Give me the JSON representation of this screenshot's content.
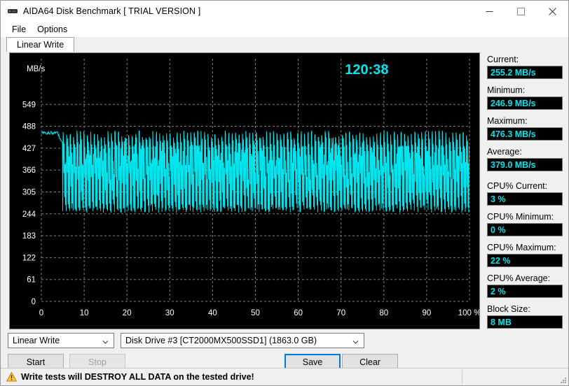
{
  "window": {
    "title": "AIDA64 Disk Benchmark  [ TRIAL VERSION ]",
    "icon": "disk-drive-icon",
    "minimize": "—",
    "maximize": "□",
    "close": "✕"
  },
  "menu": {
    "items": [
      {
        "label": "File"
      },
      {
        "label": "Options"
      }
    ]
  },
  "tabs": [
    {
      "label": "Linear Write",
      "active": true
    }
  ],
  "chart_data": {
    "type": "line",
    "title": "",
    "timer": "120:38",
    "xlabel": "",
    "ylabel": "MB/s",
    "x_unit": "%",
    "xticks": [
      "0",
      "10",
      "20",
      "30",
      "40",
      "50",
      "60",
      "70",
      "80",
      "90",
      "100 %"
    ],
    "xvalues": [
      0,
      10,
      20,
      30,
      40,
      50,
      60,
      70,
      80,
      90,
      100
    ],
    "yticks": [
      "549",
      "488",
      "427",
      "366",
      "305",
      "244",
      "183",
      "122",
      "61",
      "0"
    ],
    "yvalues": [
      549,
      488,
      427,
      366,
      305,
      244,
      183,
      122,
      61,
      0
    ],
    "ylim": [
      0,
      610
    ],
    "xlim": [
      0,
      100
    ],
    "grid": true,
    "grid_color": "#808080",
    "series_color": "#00e5ee",
    "background": "#000000",
    "axis_text_color": "#ffffff",
    "series": [
      {
        "name": "Linear Write",
        "description": "Sustained write speed oscillating between SLC-cache bursts (~476 MB/s) and direct-to-TLC writes (~247 MB/s) after the first ~5% of the drive.",
        "plateau_start_pct": 0,
        "plateau_end_pct": 5,
        "plateau_value": 474,
        "oscillation_start_pct": 5,
        "oscillation_high": 476.3,
        "oscillation_low": 247,
        "points_hint": "sawtooth, ~120 cycles across remaining 95%"
      }
    ]
  },
  "stats": [
    {
      "name": "current",
      "label": "Current:",
      "value": "255.2 MB/s"
    },
    {
      "name": "minimum",
      "label": "Minimum:",
      "value": "246.9 MB/s"
    },
    {
      "name": "maximum",
      "label": "Maximum:",
      "value": "476.3 MB/s"
    },
    {
      "name": "average",
      "label": "Average:",
      "value": "379.0 MB/s"
    },
    {
      "name": "cpu-current",
      "label": "CPU% Current:",
      "value": "3 %"
    },
    {
      "name": "cpu-minimum",
      "label": "CPU% Minimum:",
      "value": "0 %"
    },
    {
      "name": "cpu-maximum",
      "label": "CPU% Maximum:",
      "value": "22 %"
    },
    {
      "name": "cpu-average",
      "label": "CPU% Average:",
      "value": "2 %"
    },
    {
      "name": "block-size",
      "label": "Block Size:",
      "value": "8 MB"
    }
  ],
  "controls": {
    "test_select": {
      "value": "Linear Write"
    },
    "drive_select": {
      "value": "Disk Drive #3  [CT2000MX500SSD1]  (1863.0 GB)"
    },
    "start_button": "Start",
    "stop_button": "Stop",
    "save_button": "Save",
    "clear_button": "Clear"
  },
  "warning": {
    "icon": "warning-triangle-icon",
    "text": "Write tests will DESTROY ALL DATA on the tested drive!"
  },
  "colors": {
    "accent": "#00e5ee",
    "focus": "#0078d7",
    "warning": "#ffb000",
    "chart_bg": "#000000"
  }
}
